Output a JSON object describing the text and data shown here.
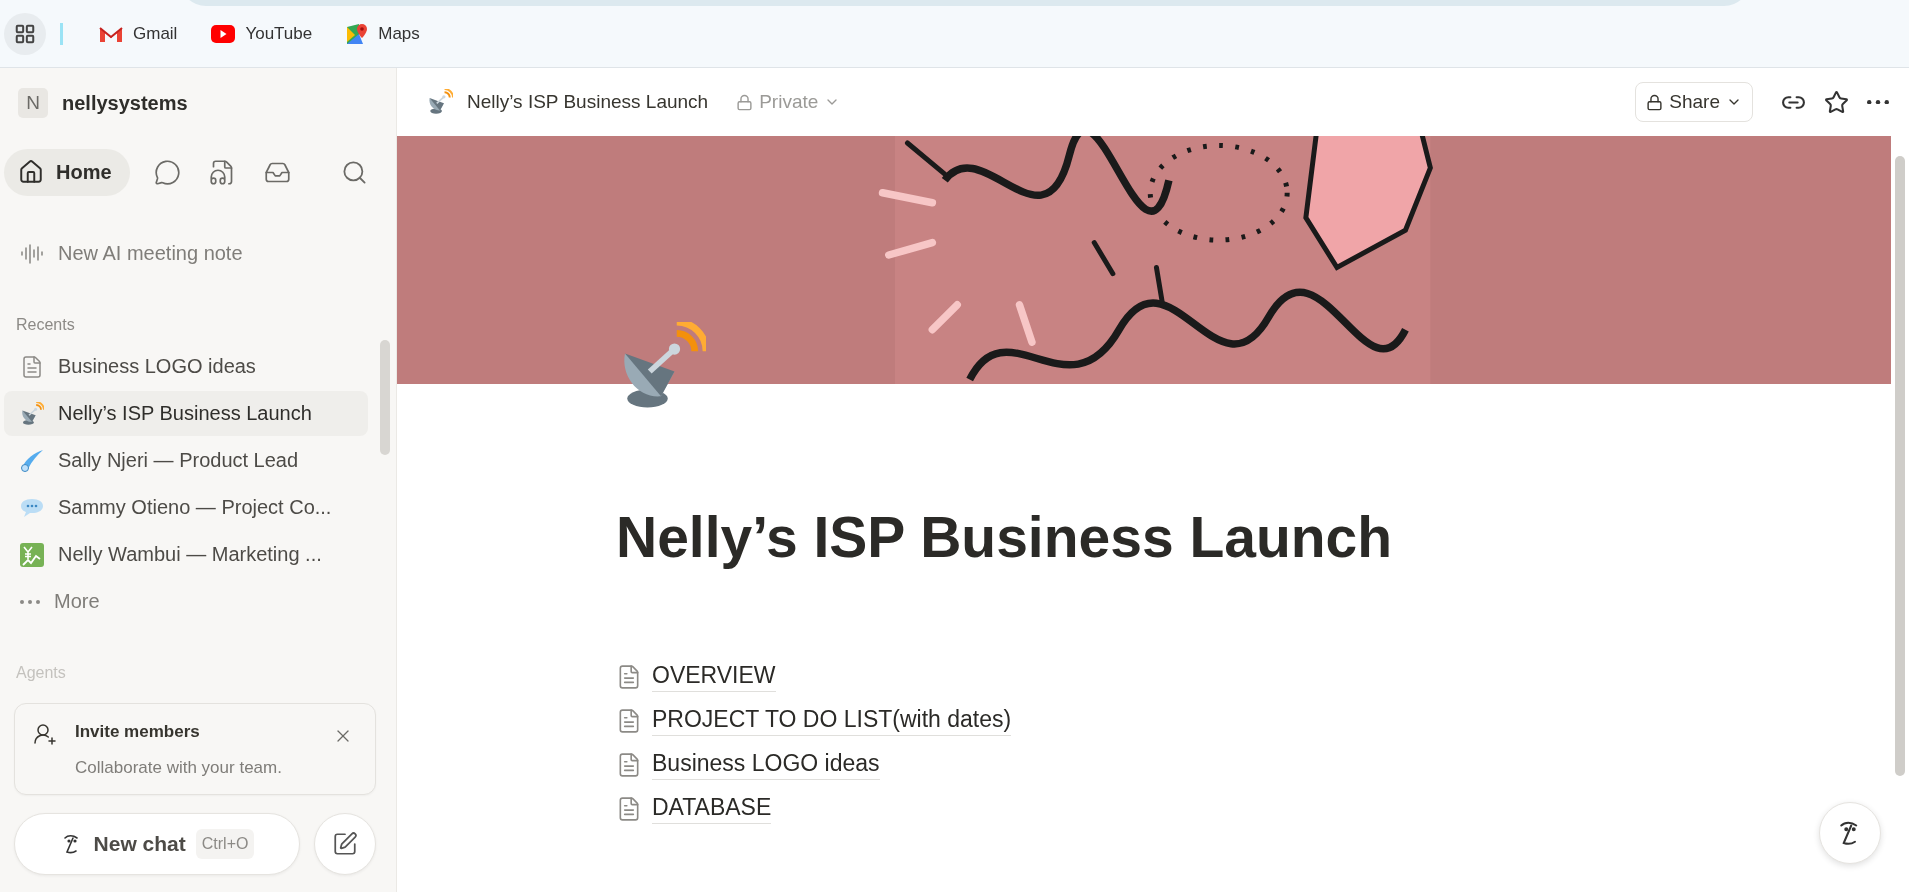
{
  "bookmarks": [
    {
      "label": "Gmail",
      "kind": "gmail"
    },
    {
      "label": "YouTube",
      "kind": "youtube"
    },
    {
      "label": "Maps",
      "kind": "maps"
    }
  ],
  "sidebar": {
    "workspace": {
      "initial": "N",
      "name": "nellysystems"
    },
    "home": {
      "label": "Home",
      "selected": true
    },
    "meeting_note": "New AI meeting note",
    "recents_heading": "Recents",
    "recents": [
      {
        "label": "Business LOGO ideas",
        "kind": "page",
        "selected": false
      },
      {
        "label": "Nelly’s ISP Business Launch",
        "kind": "satellite",
        "selected": true
      },
      {
        "label": "Sally Njeri — Product Lead",
        "kind": "comet",
        "selected": false
      },
      {
        "label": "Sammy Otieno — Project Co...",
        "kind": "speech",
        "selected": false
      },
      {
        "label": "Nelly Wambui — Marketing ...",
        "kind": "chart",
        "selected": false
      }
    ],
    "more": "More",
    "agents_heading": "Agents",
    "invite": {
      "title": "Invite members",
      "subtitle": "Collaborate with your team."
    },
    "new_chat": {
      "label": "New chat",
      "shortcut": "Ctrl+O"
    }
  },
  "header": {
    "title": "Nelly’s ISP Business Launch",
    "privacy": "Private",
    "share": "Share"
  },
  "page": {
    "title": "Nelly’s ISP Business Launch",
    "links": [
      {
        "label": "OVERVIEW"
      },
      {
        "label": "PROJECT TO DO LIST(with dates)"
      },
      {
        "label": "Business LOGO ideas"
      },
      {
        "label": "DATABASE"
      }
    ]
  }
}
